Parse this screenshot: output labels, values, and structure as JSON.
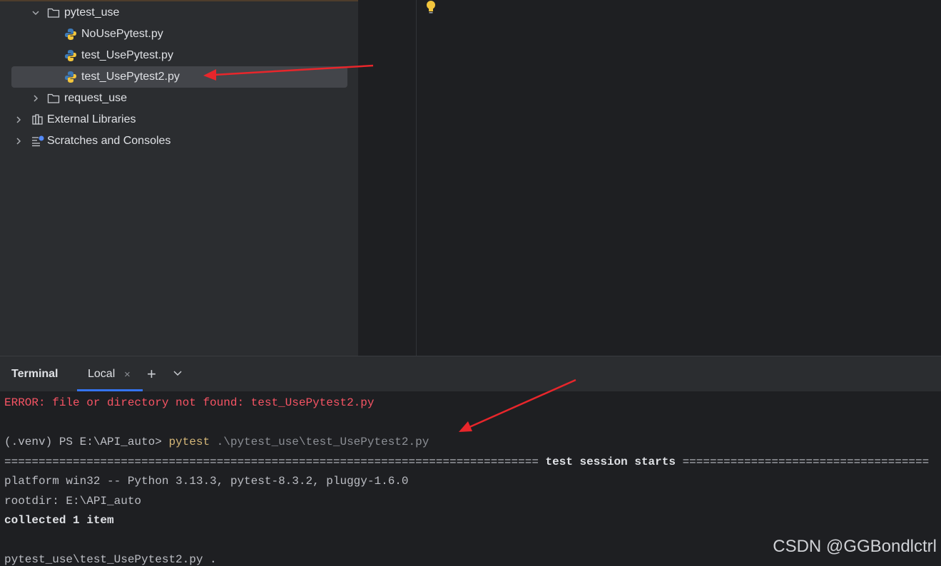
{
  "project_tree": {
    "items": [
      {
        "label": "pytest_use",
        "icon": "folder-icon",
        "expanded": true
      },
      {
        "label": "NoUsePytest.py",
        "icon": "python-file-icon"
      },
      {
        "label": "test_UsePytest.py",
        "icon": "python-file-icon"
      },
      {
        "label": "test_UsePytest2.py",
        "icon": "python-file-icon",
        "selected": true
      },
      {
        "label": "request_use",
        "icon": "folder-icon",
        "expanded": false
      },
      {
        "label": "External Libraries",
        "icon": "library-icon",
        "expanded": false
      },
      {
        "label": "Scratches and Consoles",
        "icon": "scratches-icon",
        "expanded": false
      }
    ]
  },
  "terminal": {
    "title": "Terminal",
    "tab_label": "Local",
    "close_glyph": "×",
    "add_glyph": "+",
    "output": {
      "error_line": "ERROR: file or directory not found: test_UsePytest2.py",
      "prompt": "(.venv) PS E:\\API_auto> ",
      "command": "pytest",
      "command_arg": " .\\pytest_use\\test_UsePytest2.py",
      "session_line_left": "==============================================================================",
      "session_title": " test session starts ",
      "session_line_right": "====================================",
      "platform_line": "platform win32 -- Python 3.13.3, pytest-8.3.2, pluggy-1.6.0",
      "rootdir_line": "rootdir: E:\\API_auto",
      "collected_line": "collected 1 item",
      "result_line": "pytest_use\\test_UsePytest2.py ."
    }
  },
  "watermark": "CSDN @GGBondlctrl",
  "colors": {
    "arrow": "#e8262b",
    "accent": "#3574f0",
    "error": "#f75464",
    "command": "#d5b778"
  }
}
